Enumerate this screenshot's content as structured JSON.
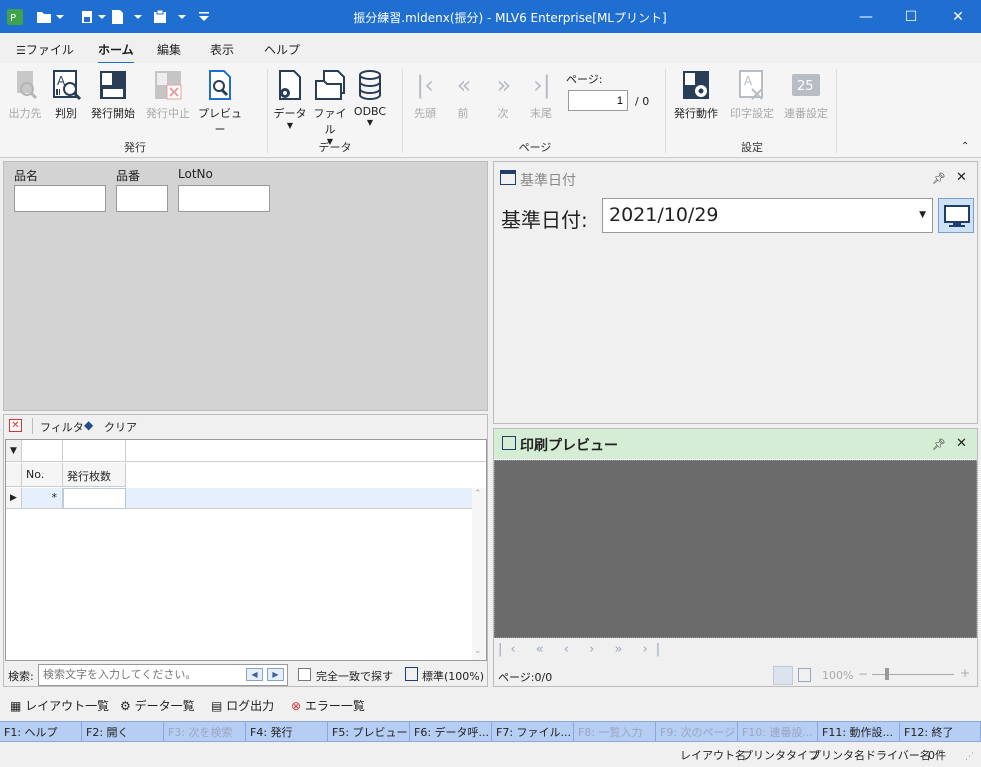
{
  "window": {
    "title": "振分練習.mldenx(振分) - MLV6 Enterprise[MLプリント]",
    "minimize": "—",
    "maximize": "☐",
    "close": "✕"
  },
  "menu": {
    "file": "ファイル",
    "home": "ホーム",
    "edit": "編集",
    "view": "表示",
    "help": "ヘルプ"
  },
  "ribbon": {
    "issue_group": "発行",
    "data_group": "データ",
    "page_group": "ページ",
    "settings_group": "設定",
    "output_dest": "出力先",
    "distinguish": "判別",
    "start_issue": "発行開始",
    "stop_issue": "発行中止",
    "preview": "プレビュー",
    "data": "データ",
    "file": "ファイル",
    "odbc": "ODBC",
    "first": "先頭",
    "prev": "前",
    "next": "次",
    "last": "末尾",
    "page_label": "ページ:",
    "page_value": "1",
    "page_total": "/ 0",
    "issue_action": "発行動作",
    "print_settings": "印字設定",
    "serial_settings": "連番設定"
  },
  "fields": {
    "product_name_label": "品名",
    "product_no_label": "品番",
    "lot_label": "LotNo"
  },
  "grid": {
    "filter": "フィルタ",
    "clear": "クリア",
    "col_no": "No.",
    "col_count": "発行枚数",
    "new_row_marker": "*"
  },
  "search": {
    "label": "検索:",
    "placeholder": "検索文字を入力してください。",
    "exact_match": "完全一致で探す",
    "standard": "標準(100%)"
  },
  "base_date_panel": {
    "title": "基準日付",
    "label": "基準日付:",
    "value": "2021/10/29"
  },
  "preview_panel": {
    "title": "印刷プレビュー",
    "page_status": "ページ:0/0",
    "zoom": "100%"
  },
  "bottom_tabs": {
    "layout_list": "レイアウト一覧",
    "data_list": "データ一覧",
    "log_output": "ログ出力",
    "error_list": "エラー一覧"
  },
  "fkeys": [
    {
      "label": "F1: ヘルプ",
      "enabled": true
    },
    {
      "label": "F2: 開く",
      "enabled": true
    },
    {
      "label": "F3: 次を検索",
      "enabled": false
    },
    {
      "label": "F4: 発行",
      "enabled": true
    },
    {
      "label": "F5: プレビュー",
      "enabled": true
    },
    {
      "label": "F6: データ呼...",
      "enabled": true
    },
    {
      "label": "F7: ファイル...",
      "enabled": true
    },
    {
      "label": "F8: 一覧入力",
      "enabled": false
    },
    {
      "label": "F9: 次のページ",
      "enabled": false
    },
    {
      "label": "F10: 連番設...",
      "enabled": false
    },
    {
      "label": "F11: 動作設...",
      "enabled": true
    },
    {
      "label": "F12: 終了",
      "enabled": true
    }
  ],
  "statusbar": {
    "layout_name": "レイアウト名",
    "printer_type": "プリンタタイプ",
    "printer_name": "プリンタ名",
    "driver_name": "ドライバー名",
    "count": "0件"
  },
  "colors": {
    "accent": "#1f6fd1",
    "preview_header": "#d5ecd5",
    "preview_area": "#6b6b6b",
    "fkey_bar": "#b6cdf4"
  }
}
